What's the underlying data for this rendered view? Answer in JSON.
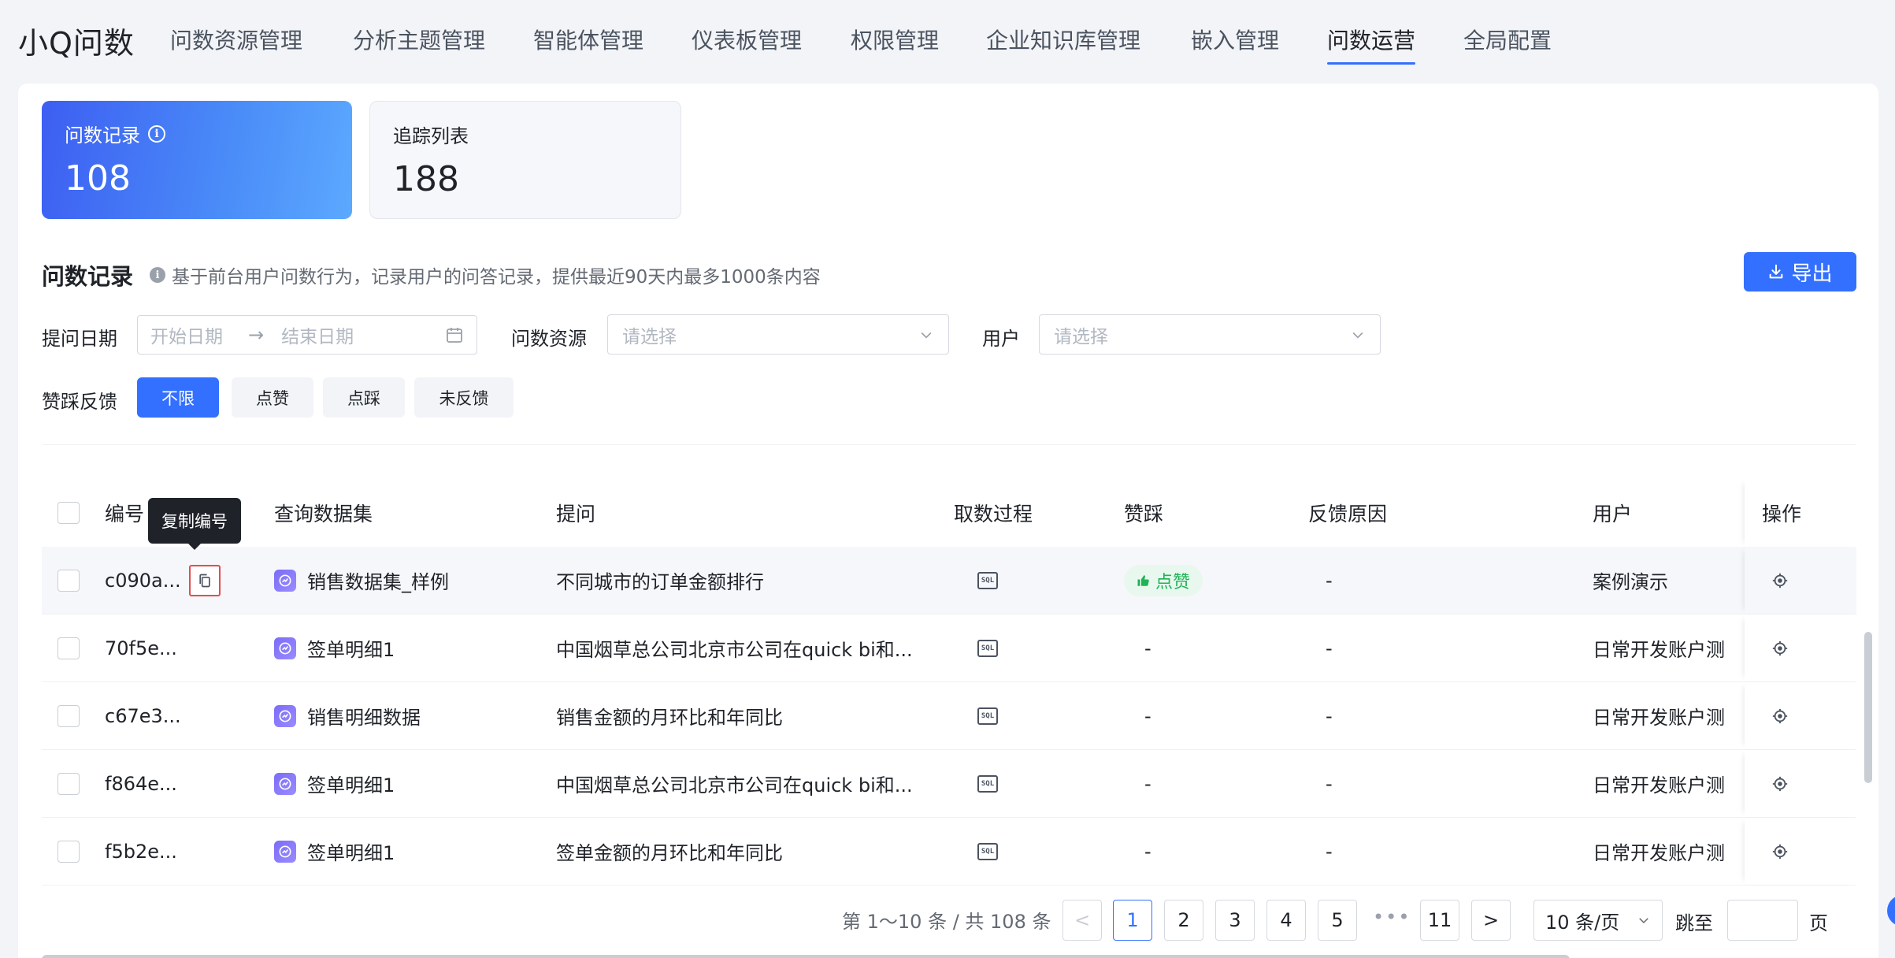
{
  "app": {
    "logo": "小Q问数"
  },
  "nav": {
    "items": [
      {
        "label": "问数资源管理"
      },
      {
        "label": "分析主题管理"
      },
      {
        "label": "智能体管理"
      },
      {
        "label": "仪表板管理"
      },
      {
        "label": "权限管理"
      },
      {
        "label": "企业知识库管理"
      },
      {
        "label": "嵌入管理"
      },
      {
        "label": "问数运营",
        "active": true
      },
      {
        "label": "全局配置"
      }
    ]
  },
  "cards": {
    "records": {
      "label": "问数记录",
      "value": "108"
    },
    "tracking": {
      "label": "追踪列表",
      "value": "188"
    }
  },
  "section": {
    "title": "问数记录",
    "desc": "基于前台用户问数行为，记录用户的问答记录，提供最近90天内最多1000条内容",
    "export_label": "导出"
  },
  "filters": {
    "date_label": "提问日期",
    "start_placeholder": "开始日期",
    "end_placeholder": "结束日期",
    "resource_label": "问数资源",
    "resource_placeholder": "请选择",
    "user_label": "用户",
    "user_placeholder": "请选择",
    "feedback_label": "赞踩反馈",
    "feedback_options": [
      "不限",
      "点赞",
      "点踩",
      "未反馈"
    ],
    "feedback_selected": "不限"
  },
  "table": {
    "columns": {
      "id": "编号",
      "dataset": "查询数据集",
      "question": "提问",
      "process": "取数过程",
      "feedback": "赞踩",
      "reason": "反馈原因",
      "user": "用户",
      "ops": "操作"
    },
    "rows": [
      {
        "id": "c090a...",
        "dataset": "销售数据集_样例",
        "question": "不同城市的订单金额排行",
        "feedback": "点赞",
        "reason": "-",
        "user": "案例演示"
      },
      {
        "id": "70f5e...",
        "dataset": "签单明细1",
        "question": "中国烟草总公司北京市公司在quick bi和...",
        "feedback": "-",
        "reason": "-",
        "user": "日常开发账户测"
      },
      {
        "id": "c67e3...",
        "dataset": "销售明细数据",
        "question": "销售金额的月环比和年同比",
        "feedback": "-",
        "reason": "-",
        "user": "日常开发账户测"
      },
      {
        "id": "f864e...",
        "dataset": "签单明细1",
        "question": "中国烟草总公司北京市公司在quick bi和...",
        "feedback": "-",
        "reason": "-",
        "user": "日常开发账户测"
      },
      {
        "id": "f5b2e...",
        "dataset": "签单明细1",
        "question": "签单金额的月环比和年同比",
        "feedback": "-",
        "reason": "-",
        "user": "日常开发账户测"
      }
    ],
    "sql_label": "SQL",
    "tooltip": "复制编号"
  },
  "pagination": {
    "summary": "第 1～10 条 / 共 108 条",
    "pages": [
      "1",
      "2",
      "3",
      "4",
      "5"
    ],
    "last_page": "11",
    "dots": "•••",
    "prev": "<",
    "next": ">",
    "page_size": "10 条/页",
    "jump_label": "跳至",
    "page_suffix": "页"
  },
  "colors": {
    "primary": "#3370ff",
    "like": "#1fb356",
    "tooltip": "#1f2329"
  }
}
